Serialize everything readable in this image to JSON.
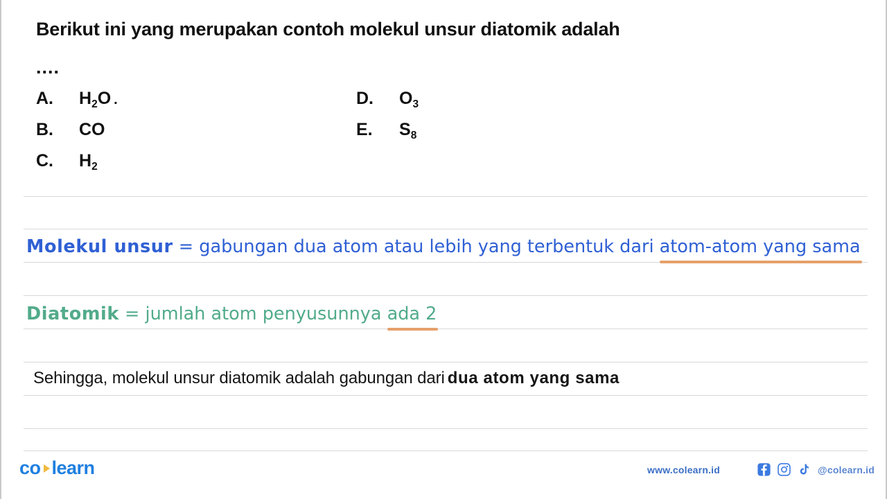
{
  "question": {
    "text": "Berikut ini yang merupakan contoh molekul unsur diatomik adalah",
    "dots": "...."
  },
  "options": [
    {
      "label": "A.",
      "formula_main": "H",
      "formula_sub": "2",
      "formula_tail": "O",
      "trailing": "."
    },
    {
      "label": "B.",
      "formula_main": "CO",
      "formula_sub": "",
      "formula_tail": "",
      "trailing": ""
    },
    {
      "label": "C.",
      "formula_main": "H",
      "formula_sub": "2",
      "formula_tail": "",
      "trailing": ""
    },
    {
      "label": "D.",
      "formula_main": "O",
      "formula_sub": "3",
      "formula_tail": "",
      "trailing": ""
    },
    {
      "label": "E.",
      "formula_main": "S",
      "formula_sub": "8",
      "formula_tail": "",
      "trailing": ""
    }
  ],
  "explanations": [
    {
      "keyword": "Molekul unsur",
      "body": " = gabungan dua atom atau lebih yang terbentuk dari ",
      "highlight": "atom-atom yang sama",
      "color": "#2f60d4",
      "underline_color": "#e5a06a"
    },
    {
      "keyword": "Diatomik",
      "body": " = jumlah atom penyusunnya ",
      "highlight": "ada 2",
      "color": "#52ab8b",
      "underline_color": "#e5a06a"
    }
  ],
  "conclusion": {
    "text": "Sehingga, molekul unsur diatomik adalah gabungan dari",
    "emphasis": "dua atom yang sama"
  },
  "footer": {
    "logo_first": "co",
    "logo_second": "learn",
    "website": "www.colearn.id",
    "handle": "@colearn.id",
    "social": [
      "facebook-icon",
      "instagram-icon",
      "tiktok-icon"
    ]
  },
  "colors": {
    "brand_blue": "#1f7fe0",
    "logo_accent": "#f0b93c",
    "blue_text": "#2f60d4",
    "green_text": "#52ab8b",
    "orange_underline": "#e5a06a",
    "rule_line": "#d8d8dc"
  },
  "rule_lines_y": [
    283,
    330,
    378,
    426,
    474,
    522,
    570,
    618,
    650
  ]
}
